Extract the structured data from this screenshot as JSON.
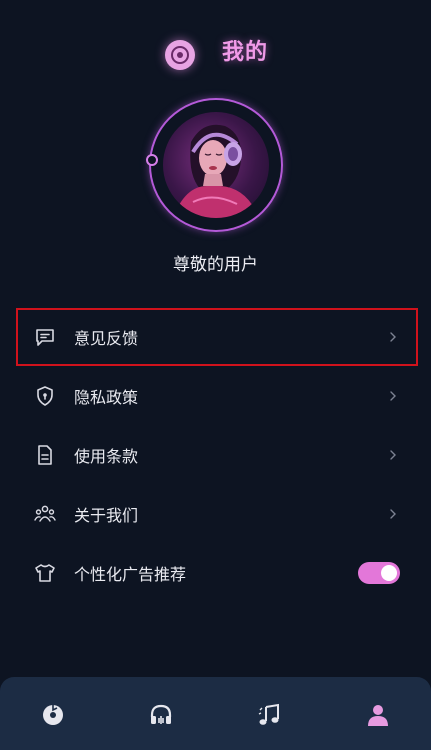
{
  "header": {
    "title": "我的",
    "logo_icon": "vinyl-record-icon"
  },
  "profile": {
    "username": "尊敬的用户",
    "avatar": "user-avatar"
  },
  "menu": {
    "items": [
      {
        "label": "意见反馈",
        "icon": "feedback-icon",
        "highlighted": true
      },
      {
        "label": "隐私政策",
        "icon": "shield-icon"
      },
      {
        "label": "使用条款",
        "icon": "document-icon"
      },
      {
        "label": "关于我们",
        "icon": "group-icon"
      },
      {
        "label": "个性化广告推荐",
        "icon": "tshirt-icon",
        "toggle_on": true
      }
    ]
  },
  "bottom_nav": {
    "items": [
      {
        "icon": "music-disc-icon"
      },
      {
        "icon": "headphones-icon"
      },
      {
        "icon": "music-notes-icon"
      },
      {
        "icon": "profile-icon",
        "active": true
      }
    ]
  },
  "colors": {
    "background": "#0d1422",
    "accent": "#e377d9",
    "highlight_border": "#d0121c",
    "nav_background": "#1c2c44"
  }
}
